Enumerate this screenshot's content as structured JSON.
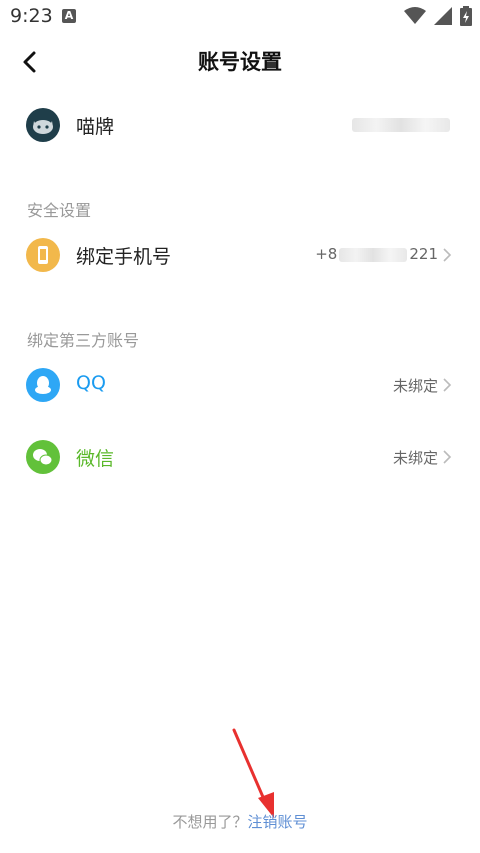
{
  "statusbar": {
    "time": "9:23",
    "notif_badge": "A"
  },
  "header": {
    "title": "账号设置"
  },
  "profile": {
    "name": "喵牌"
  },
  "security": {
    "section_title": "安全设置",
    "phone_label": "绑定手机号",
    "phone_prefix": "+8",
    "phone_suffix": "221"
  },
  "third_party": {
    "section_title": "绑定第三方账号",
    "qq": {
      "label": "QQ",
      "status": "未绑定",
      "color": "#1a9bf0"
    },
    "wechat": {
      "label": "微信",
      "status": "未绑定",
      "color": "#5ab82a"
    }
  },
  "footer": {
    "question": "不想用了？",
    "link": "注销账号"
  },
  "colors": {
    "qq_icon_bg": "#2ea7f5",
    "wechat_icon_bg": "#62c13a",
    "phone_icon_bg": "#f2b84b",
    "link": "#5f8fd4",
    "annotation_arrow": "#e8312f"
  },
  "annotation": {
    "target": "注销账号"
  }
}
